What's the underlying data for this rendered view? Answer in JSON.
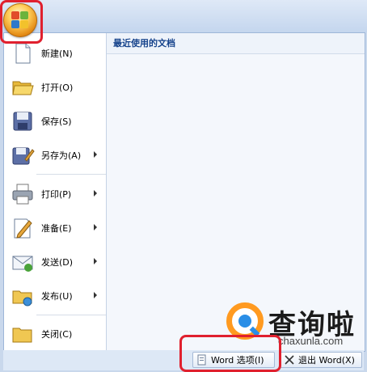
{
  "menu": {
    "items": [
      {
        "label": "新建(N)",
        "icon": "new-document-icon",
        "submenu": false
      },
      {
        "label": "打开(O)",
        "icon": "open-folder-icon",
        "submenu": false
      },
      {
        "label": "保存(S)",
        "icon": "save-disk-icon",
        "submenu": false
      },
      {
        "label": "另存为(A)",
        "icon": "save-as-icon",
        "submenu": true
      },
      {
        "label": "打印(P)",
        "icon": "printer-icon",
        "submenu": true
      },
      {
        "label": "准备(E)",
        "icon": "prepare-pencil-icon",
        "submenu": true
      },
      {
        "label": "发送(D)",
        "icon": "send-mail-icon",
        "submenu": true
      },
      {
        "label": "发布(U)",
        "icon": "publish-folder-icon",
        "submenu": true
      },
      {
        "label": "关闭(C)",
        "icon": "close-folder-icon",
        "submenu": false
      }
    ]
  },
  "recent": {
    "header": "最近使用的文档"
  },
  "footer": {
    "options_label": "Word 选项(I)",
    "exit_label": "退出 Word(X)"
  },
  "watermark": {
    "brand": "查询啦",
    "site": "chaxunla.com"
  },
  "colors": {
    "highlight": "#e0202e",
    "text_blue": "#15428b",
    "orange": "#ff9a20"
  }
}
